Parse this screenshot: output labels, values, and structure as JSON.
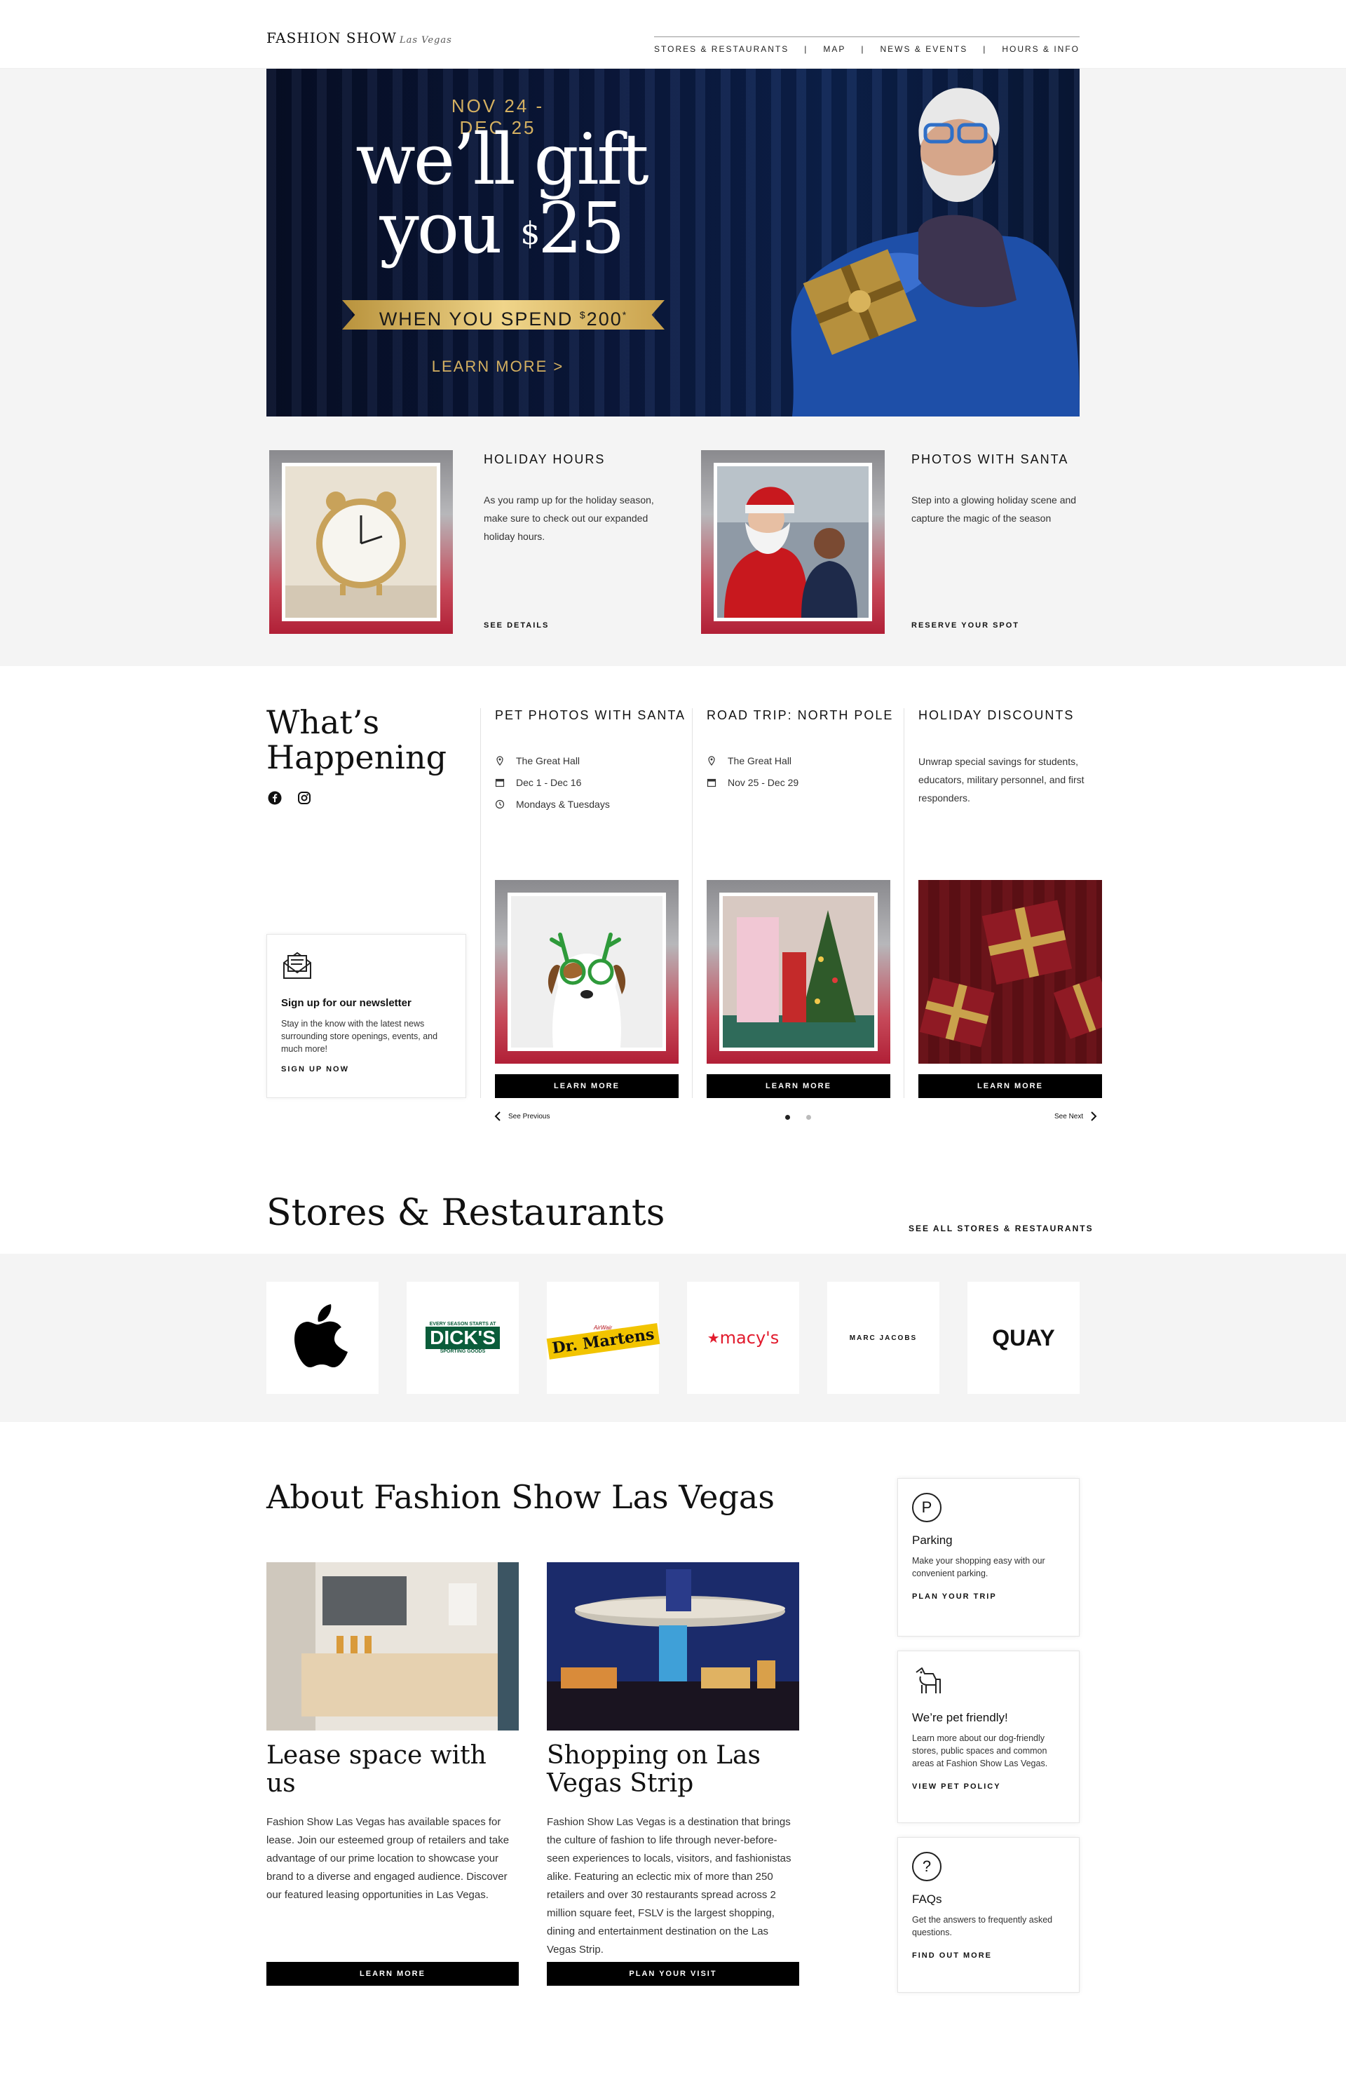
{
  "header": {
    "logo": "FASHION SHOW",
    "logo_script": "Las Vegas",
    "nav": [
      "STORES & RESTAURANTS",
      "MAP",
      "NEWS & EVENTS",
      "HOURS & INFO"
    ]
  },
  "hero": {
    "date": "NOV 24 - DEC 25",
    "line1": "we’ll gift",
    "line2_word": "you",
    "line2_sup": "$",
    "line2_amount": "25",
    "ribbon_text": "WHEN YOU SPEND",
    "ribbon_sup": "$",
    "ribbon_amount": "200",
    "ribbon_star": "*",
    "cta": "LEARN MORE >"
  },
  "features": [
    {
      "title": "HOLIDAY HOURS",
      "desc": "As you ramp up for the holiday season, make sure to check out our expanded holiday hours.",
      "link": "SEE DETAILS"
    },
    {
      "title": "PHOTOS WITH SANTA",
      "desc": "Step into a glowing holiday scene and capture the magic of the season",
      "link": "RESERVE YOUR SPOT"
    }
  ],
  "happening": {
    "title_line1": "What’s",
    "title_line2": "Happening",
    "newsletter": {
      "title": "Sign up for our newsletter",
      "desc": "Stay in the know with the latest news surrounding store openings, events, and much more!",
      "link": "SIGN UP NOW"
    },
    "events": [
      {
        "title": "PET PHOTOS WITH SANTA",
        "location": "The Great Hall",
        "dates": "Dec 1 - Dec 16",
        "time": "Mondays & Tuesdays",
        "button": "LEARN MORE"
      },
      {
        "title": "ROAD TRIP: NORTH POLE",
        "location": "The Great Hall",
        "dates": "Nov 25 - Dec 29",
        "button": "LEARN MORE"
      },
      {
        "title": "HOLIDAY DISCOUNTS",
        "desc": "Unwrap special savings for students, educators, military personnel, and first responders.",
        "button": "LEARN MORE"
      }
    ],
    "prev": "See Previous",
    "next": "See Next"
  },
  "stores": {
    "title": "Stores & Restaurants",
    "see_all": "SEE ALL STORES & RESTAURANTS",
    "logos": [
      {
        "name": "Apple",
        "text": ""
      },
      {
        "name": "DICK'S Sporting Goods",
        "top": "EVERY SEASON STARTS AT",
        "main": "DICK'S",
        "sub": "SPORTING GOODS"
      },
      {
        "name": "Dr. Martens",
        "main": "Dr. Martens",
        "sub": "AirWair"
      },
      {
        "name": "Macy's",
        "star": "★",
        "main": "macy's"
      },
      {
        "name": "Marc Jacobs",
        "main": "MARC JACOBS"
      },
      {
        "name": "Quay",
        "main": "QUAY"
      }
    ]
  },
  "about": {
    "title": "About Fashion Show Las Vegas",
    "cards": [
      {
        "heading": "Lease space with us",
        "text": "Fashion Show Las Vegas has available spaces for lease. Join our esteemed group of retailers and take advantage of our prime location to showcase your brand to a diverse and engaged audience. Discover our featured leasing opportunities in Las Vegas.",
        "button": "LEARN MORE"
      },
      {
        "heading": "Shopping on Las Vegas Strip",
        "text": "Fashion Show Las Vegas is a destination that brings the culture of fashion to life through never-before-seen experiences to locals, visitors, and fashionistas alike. Featuring an eclectic mix of more than 250 retailers and over 30 restaurants spread across 2 million square feet, FSLV is the largest shopping, dining and entertainment destination on the Las Vegas Strip.",
        "button": "PLAN YOUR VISIT"
      }
    ],
    "side": [
      {
        "icon": "P",
        "title": "Parking",
        "desc": "Make your shopping easy with our convenient parking.",
        "link": "PLAN YOUR TRIP"
      },
      {
        "title": "We’re pet friendly!",
        "desc": "Learn more about our dog-friendly stores, public spaces and common areas at Fashion Show Las Vegas.",
        "link": "VIEW PET POLICY"
      },
      {
        "icon": "?",
        "title": "FAQs",
        "desc": "Get the answers to frequently asked questions.",
        "link": "FIND OUT MORE"
      }
    ]
  }
}
